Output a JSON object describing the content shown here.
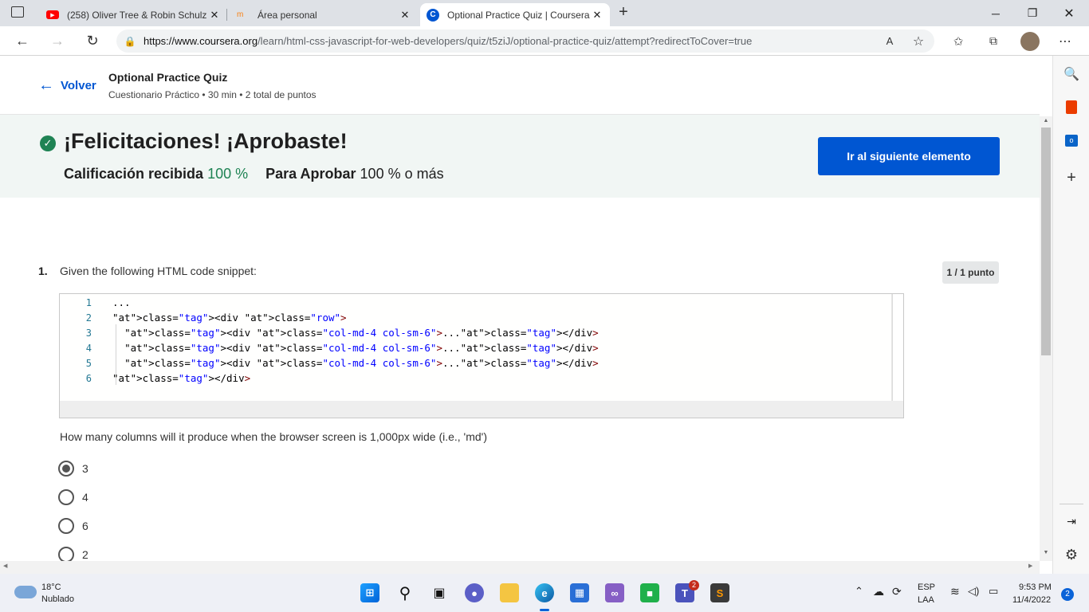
{
  "browser": {
    "tabs": [
      {
        "title": "(258) Oliver Tree & Robin Schulz",
        "icon": "youtube-icon"
      },
      {
        "title": "Área personal",
        "icon": "moodle-icon"
      },
      {
        "title": "Optional Practice Quiz | Coursera",
        "icon": "coursera-icon",
        "active": true
      }
    ],
    "url": {
      "host": "https://www.coursera.org",
      "path": "/learn/html-css-javascript-for-web-developers/quiz/t5ziJ/optional-practice-quiz/attempt?redirectToCover=true"
    }
  },
  "header": {
    "back_label": "Volver",
    "quiz_title": "Optional Practice Quiz",
    "quiz_meta": "Cuestionario Práctico • 30 min • 2 total de puntos"
  },
  "banner": {
    "heading": "¡Felicitaciones! ¡Aprobaste!",
    "grade_label": "Calificación recibida",
    "grade_value": "100 %",
    "pass_label": "Para Aprobar",
    "pass_value": "100 % o más",
    "next_button": "Ir al siguiente elemento",
    "success_color": "#1f8354",
    "accent_color": "#0056d2"
  },
  "question": {
    "number": "1.",
    "prompt": "Given the following HTML code snippet:",
    "points": "1 / 1 punto",
    "code_lines": [
      {
        "num": "1",
        "text": "..."
      },
      {
        "num": "2",
        "text": "<div class=\"row\">"
      },
      {
        "num": "3",
        "text": "  <div class=\"col-md-4 col-sm-6\">...</div>"
      },
      {
        "num": "4",
        "text": "  <div class=\"col-md-4 col-sm-6\">...</div>"
      },
      {
        "num": "5",
        "text": "  <div class=\"col-md-4 col-sm-6\">...</div>"
      },
      {
        "num": "6",
        "text": "</div>"
      }
    ],
    "followup": "How many columns will it produce when the browser screen is 1,000px wide (i.e., 'md')",
    "options": [
      {
        "label": "3",
        "selected": true
      },
      {
        "label": "4",
        "selected": false
      },
      {
        "label": "6",
        "selected": false
      },
      {
        "label": "2",
        "selected": false
      }
    ]
  },
  "taskbar": {
    "weather_temp": "18°C",
    "weather_desc": "Nublado",
    "lang_top": "ESP",
    "lang_bottom": "LAA",
    "time": "9:53 PM",
    "date": "11/4/2022",
    "notif_count": "2",
    "teams_badge": "2"
  }
}
